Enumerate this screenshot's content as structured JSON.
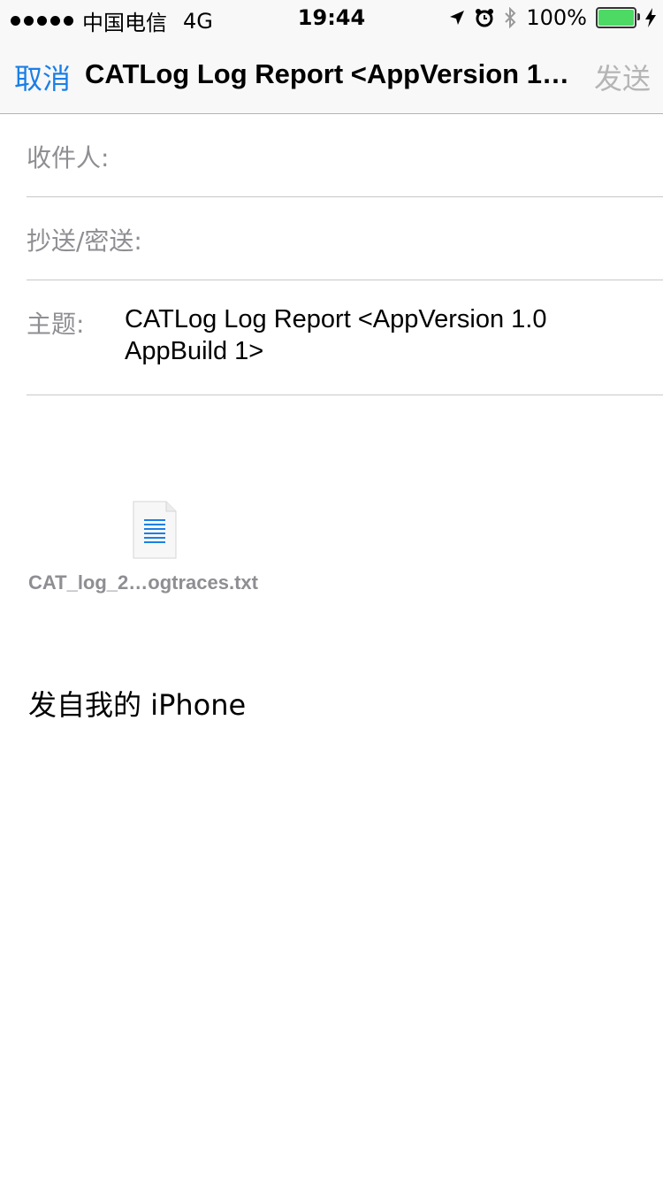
{
  "status_bar": {
    "carrier": "中国电信",
    "network": "4G",
    "time": "19:44",
    "battery_percent": "100%"
  },
  "nav": {
    "cancel_label": "取消",
    "title": "CATLog Log Report <AppVersion 1.0 AppBuild 1>",
    "send_label": "发送"
  },
  "fields": {
    "to_label": "收件人:",
    "cc_label": "抄送/密送:",
    "subject_label": "主题:",
    "subject_value": "CATLog Log Report <AppVersion 1.0 AppBuild 1>"
  },
  "attachment": {
    "filename": "CAT_log_2…ogtraces.txt",
    "icon": "text-document-icon"
  },
  "body": {
    "signature": "发自我的 iPhone"
  },
  "colors": {
    "accent": "#1a7fe6",
    "disabled": "#b5b5b5",
    "label": "#8e8e93",
    "battery": "#4cd964"
  }
}
